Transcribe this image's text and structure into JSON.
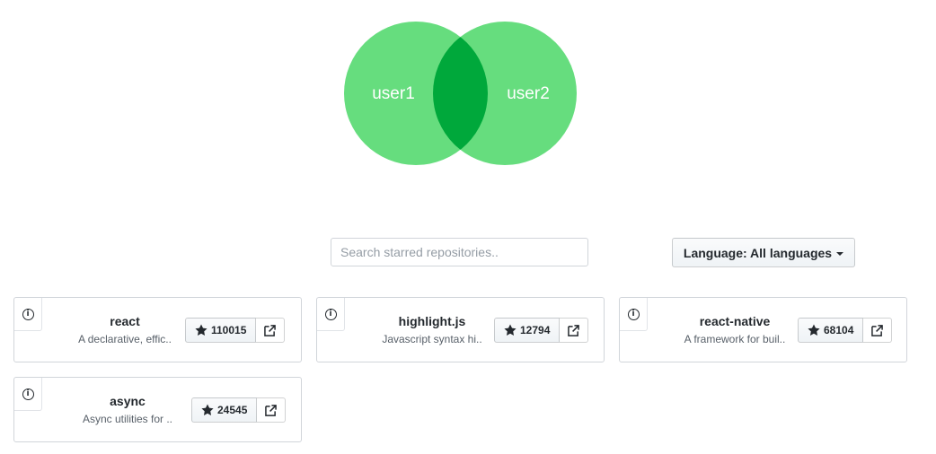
{
  "venn": {
    "left_label": "user1",
    "right_label": "user2",
    "colors": {
      "circle": "#66dd7e",
      "overlap": "#00a83b"
    }
  },
  "search": {
    "placeholder": "Search starred repositories.."
  },
  "language_filter": {
    "label": "Language: All languages"
  },
  "repos": [
    {
      "name": "react",
      "description": "A declarative, effic..",
      "stars": "110015"
    },
    {
      "name": "highlight.js",
      "description": "Javascript syntax hi..",
      "stars": "12794"
    },
    {
      "name": "react-native",
      "description": "A framework for buil..",
      "stars": "68104"
    },
    {
      "name": "async",
      "description": "Async utilities for ..",
      "stars": "24545"
    }
  ]
}
